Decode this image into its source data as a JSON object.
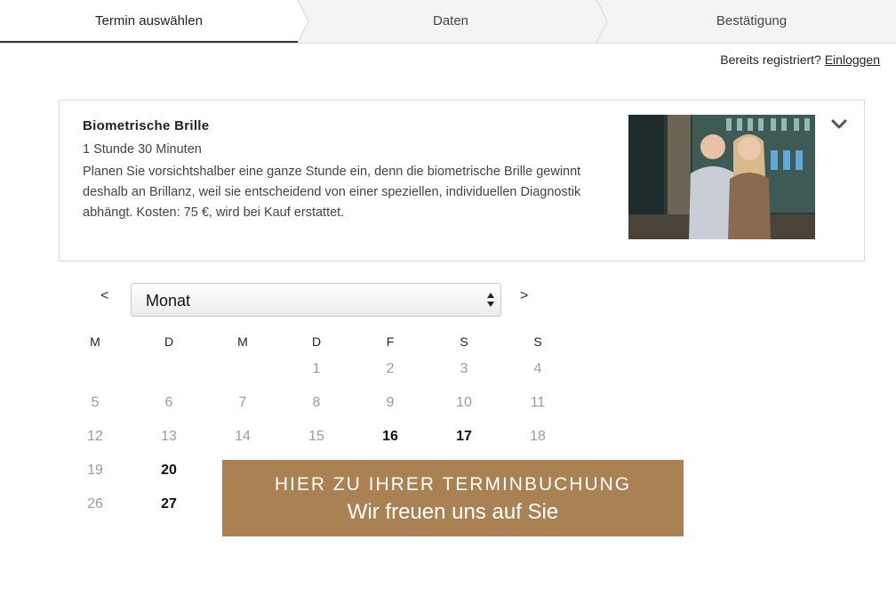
{
  "steps": [
    {
      "label": "Termin auswählen",
      "active": true
    },
    {
      "label": "Daten",
      "active": false
    },
    {
      "label": "Bestätigung",
      "active": false
    }
  ],
  "login": {
    "prompt": "Bereits registriert?",
    "link": "Einloggen"
  },
  "service": {
    "title": "Biometrische Brille",
    "duration": "1 Stunde 30 Minuten",
    "description": "Planen Sie vorsichtshalber eine ganze Stunde ein, denn die biometrische Brille gewinnt deshalb an Brillanz, weil sie entscheidend von einer speziellen, individuellen Diagnostik abhängt. Kosten: 75 €, wird bei Kauf erstattet.",
    "toggle_icon": "chevron-down-icon"
  },
  "calendar": {
    "prev": "<",
    "next": ">",
    "month_select": "Monat",
    "weekdays": [
      "M",
      "D",
      "M",
      "D",
      "F",
      "S",
      "S"
    ],
    "days": [
      {
        "d": "1",
        "avail": false
      },
      {
        "d": "2",
        "avail": false
      },
      {
        "d": "3",
        "avail": false
      },
      {
        "d": "4",
        "avail": false
      },
      {
        "d": "5",
        "avail": false
      },
      {
        "d": "6",
        "avail": false
      },
      {
        "d": "7",
        "avail": false
      },
      {
        "d": "8",
        "avail": false
      },
      {
        "d": "9",
        "avail": false
      },
      {
        "d": "10",
        "avail": false
      },
      {
        "d": "11",
        "avail": false
      },
      {
        "d": "12",
        "avail": false
      },
      {
        "d": "13",
        "avail": false
      },
      {
        "d": "14",
        "avail": false
      },
      {
        "d": "15",
        "avail": false
      },
      {
        "d": "16",
        "avail": true
      },
      {
        "d": "17",
        "avail": true
      },
      {
        "d": "18",
        "avail": false
      },
      {
        "d": "19",
        "avail": false
      },
      {
        "d": "20",
        "avail": true
      },
      {
        "d": "26",
        "avail": false
      },
      {
        "d": "27",
        "avail": true
      }
    ]
  },
  "banner": {
    "line1": "HIER ZU IHRER TERMINBUCHUNG",
    "line2": "Wir freuen uns auf Sie",
    "color": "#a98153"
  }
}
